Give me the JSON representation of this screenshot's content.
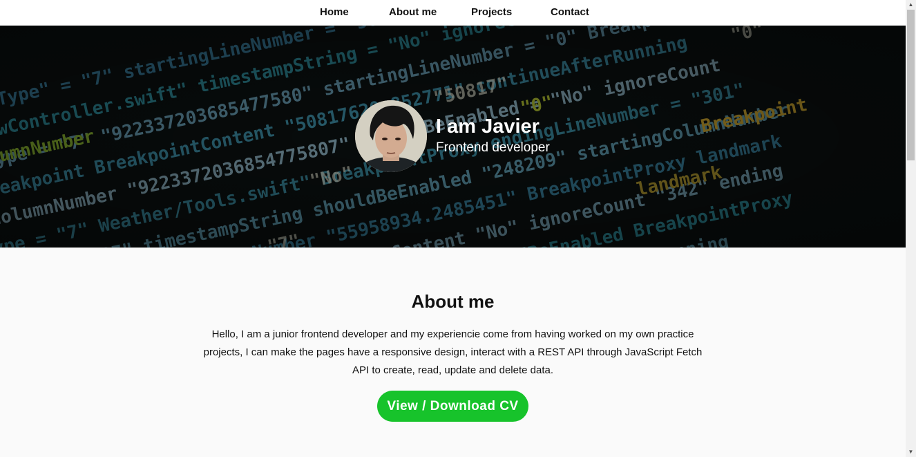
{
  "nav": {
    "items": [
      {
        "label": "Home"
      },
      {
        "label": "About me"
      },
      {
        "label": "Projects"
      },
      {
        "label": "Contact"
      }
    ]
  },
  "hero": {
    "name": "I am Javier",
    "role": "Frontend developer"
  },
  "about": {
    "title": "About me",
    "text": "Hello, I am a junior frontend developer and my experiencie come from having worked on my own practice projects, I can make the pages have a responsive design, interact with a REST API through JavaScript Fetch API to create, read, update and delete data.",
    "cv_button": "View / Download CV"
  },
  "colors": {
    "accent_button": "#17c32b",
    "nav_background": "#ffffff",
    "page_background": "#fafafa"
  },
  "icons": {
    "scroll_up": "triangle-up-icon",
    "scroll_down": "triangle-down-icon"
  }
}
